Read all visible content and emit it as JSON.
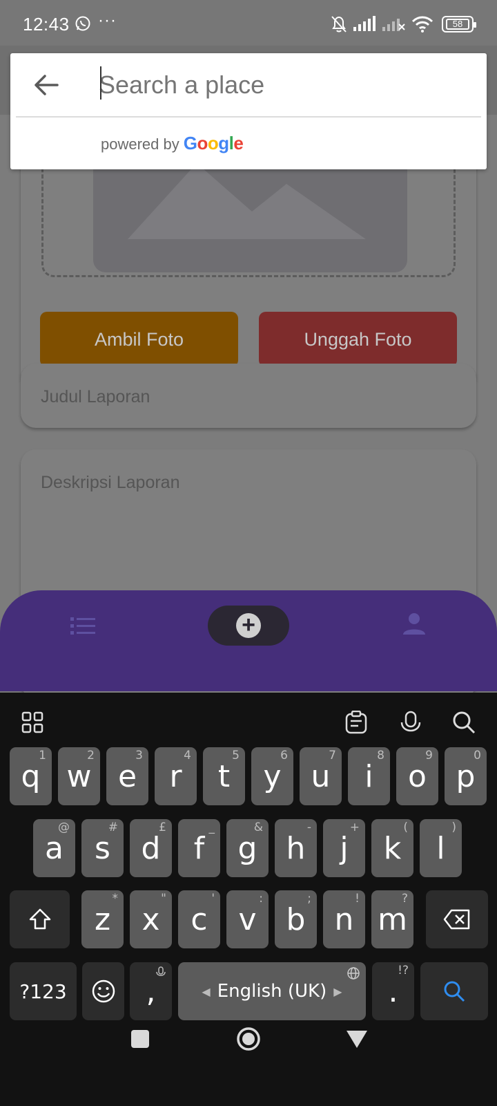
{
  "status_bar": {
    "time": "12:43",
    "more": "···",
    "battery": "58"
  },
  "search": {
    "placeholder": "Search a place",
    "powered_by": "powered by",
    "google_letters": [
      "G",
      "o",
      "o",
      "g",
      "l",
      "e"
    ],
    "google_colors": [
      "#4285F4",
      "#EA4335",
      "#FBBC05",
      "#4285F4",
      "#34A853",
      "#EA4335"
    ]
  },
  "form": {
    "take_photo_label": "Ambil Foto",
    "upload_photo_label": "Unggah Foto",
    "title_placeholder": "Judul Laporan",
    "description_placeholder": "Deskripsi Laporan"
  },
  "keyboard": {
    "row1": [
      {
        "key": "q",
        "hint": "1"
      },
      {
        "key": "w",
        "hint": "2"
      },
      {
        "key": "e",
        "hint": "3"
      },
      {
        "key": "r",
        "hint": "4"
      },
      {
        "key": "t",
        "hint": "5"
      },
      {
        "key": "y",
        "hint": "6"
      },
      {
        "key": "u",
        "hint": "7"
      },
      {
        "key": "i",
        "hint": "8"
      },
      {
        "key": "o",
        "hint": "9"
      },
      {
        "key": "p",
        "hint": "0"
      }
    ],
    "row2": [
      {
        "key": "a",
        "hint": "@"
      },
      {
        "key": "s",
        "hint": "#"
      },
      {
        "key": "d",
        "hint": "£"
      },
      {
        "key": "f",
        "hint": "_"
      },
      {
        "key": "g",
        "hint": "&"
      },
      {
        "key": "h",
        "hint": "-"
      },
      {
        "key": "j",
        "hint": "+"
      },
      {
        "key": "k",
        "hint": "("
      },
      {
        "key": "l",
        "hint": ")"
      }
    ],
    "row3": [
      {
        "key": "z",
        "hint": "*"
      },
      {
        "key": "x",
        "hint": "\""
      },
      {
        "key": "c",
        "hint": "'"
      },
      {
        "key": "v",
        "hint": ":"
      },
      {
        "key": "b",
        "hint": ";"
      },
      {
        "key": "n",
        "hint": "!"
      },
      {
        "key": "m",
        "hint": "?"
      }
    ],
    "symbols_label": "?123",
    "comma": ",",
    "space_label": "English (UK)",
    "period": ".",
    "period_hint": "!?"
  }
}
